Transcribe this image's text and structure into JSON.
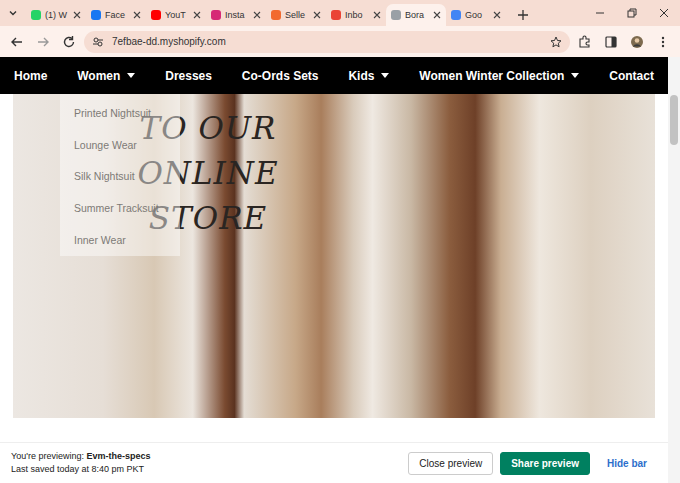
{
  "browser": {
    "tabs": [
      {
        "label": "(1) W",
        "selected": false,
        "color": "#25d366"
      },
      {
        "label": "Face",
        "selected": false,
        "color": "#1877f2"
      },
      {
        "label": "YouT",
        "selected": false,
        "color": "#ff0000"
      },
      {
        "label": "Insta",
        "selected": false,
        "color": "#d62976"
      },
      {
        "label": "Selle",
        "selected": false,
        "color": "#f26a2e"
      },
      {
        "label": "Inbo",
        "selected": false,
        "color": "#ea4335"
      },
      {
        "label": "Bora",
        "selected": true,
        "color": "#9aa0a6"
      },
      {
        "label": "Goo",
        "selected": false,
        "color": "#4285f4"
      }
    ],
    "address": "7efbae-dd.myshopify.com"
  },
  "nav": {
    "items": [
      {
        "label": "Home",
        "dropdown": false
      },
      {
        "label": "Women",
        "dropdown": true
      },
      {
        "label": "Dresses",
        "dropdown": false
      },
      {
        "label": "Co-Ords Sets",
        "dropdown": false
      },
      {
        "label": "Kids",
        "dropdown": true
      },
      {
        "label": "Women Winter Collection",
        "dropdown": true
      },
      {
        "label": "Contact",
        "dropdown": false
      }
    ]
  },
  "dropdown": {
    "items": [
      "Printed Nightsuit",
      "Lounge Wear",
      "Silk Nightsuit",
      "Summer Tracksuit",
      "Inner Wear"
    ]
  },
  "hero": {
    "lines": [
      "TO OUR",
      "ONLINE",
      "STORE"
    ]
  },
  "preview_bar": {
    "previewing_label": "You're previewing:",
    "theme": "Evm-the-specs",
    "saved": "Last saved today at 8:40 pm PKT",
    "buttons": [
      {
        "label": "Close preview",
        "kind": "plain"
      },
      {
        "label": "Share preview",
        "kind": "primary"
      },
      {
        "label": "Hide bar",
        "kind": "link"
      }
    ]
  }
}
